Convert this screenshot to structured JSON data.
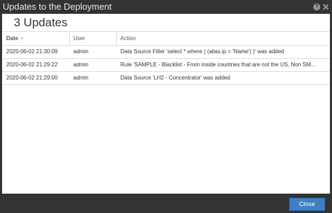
{
  "dialog": {
    "title": "Updates to the Deployment",
    "help_icon": "?",
    "icons": [
      "help-icon",
      "close-icon"
    ]
  },
  "panel": {
    "heading": "3 Updates"
  },
  "table": {
    "columns": {
      "date": "Date",
      "user": "User",
      "action": "Action"
    },
    "sort_indicator": "⌄",
    "rows": [
      {
        "date": "2020-06-02 21:30:09",
        "user": "admin",
        "action": "Data Source Filter 'select * where ( (alias.ip = 'Name') )' was added"
      },
      {
        "date": "2020-06-02 21:29:22",
        "user": "admin",
        "action": "Rule 'SAMPLE - Blacklist - From inside countries that are not the US, Non SM..."
      },
      {
        "date": "2020-06-02 21:29:00",
        "user": "admin",
        "action": "Data Source 'LH2 - Concentrator' was added"
      }
    ]
  },
  "footer": {
    "close_label": "Close"
  },
  "colors": {
    "title_bar": "#333333",
    "panel_bg": "#ffffff",
    "close_button": "#3e7fc2"
  }
}
